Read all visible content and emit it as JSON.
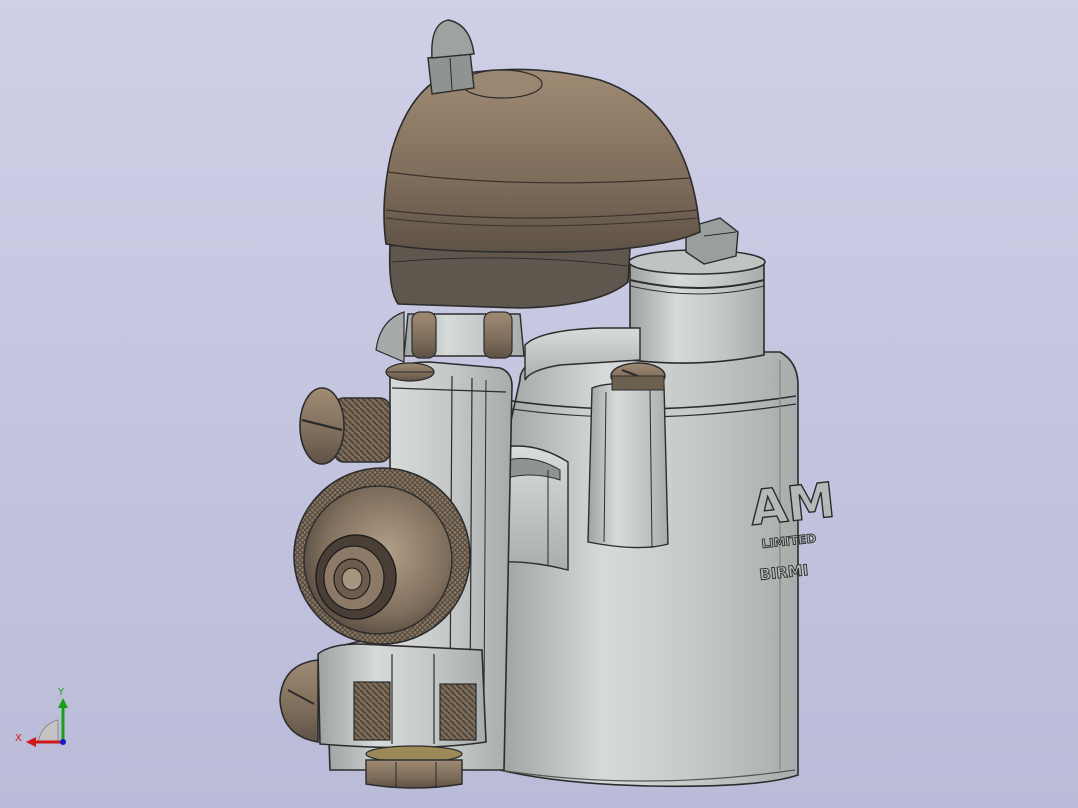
{
  "viewport": {
    "background_top": "#cfcfe7",
    "background_bottom": "#babbd8"
  },
  "model": {
    "body_color": "#c5c9c8",
    "brass_color": "#8c7964",
    "dark_color": "#4e4a43",
    "embossed_text": [
      "AM",
      "LIMITED",
      "BIRMI"
    ]
  },
  "triad": {
    "x_label": "X",
    "y_label": "Y",
    "x_color": "#d01818",
    "y_color": "#18a018",
    "z_color": "#1818c8"
  }
}
